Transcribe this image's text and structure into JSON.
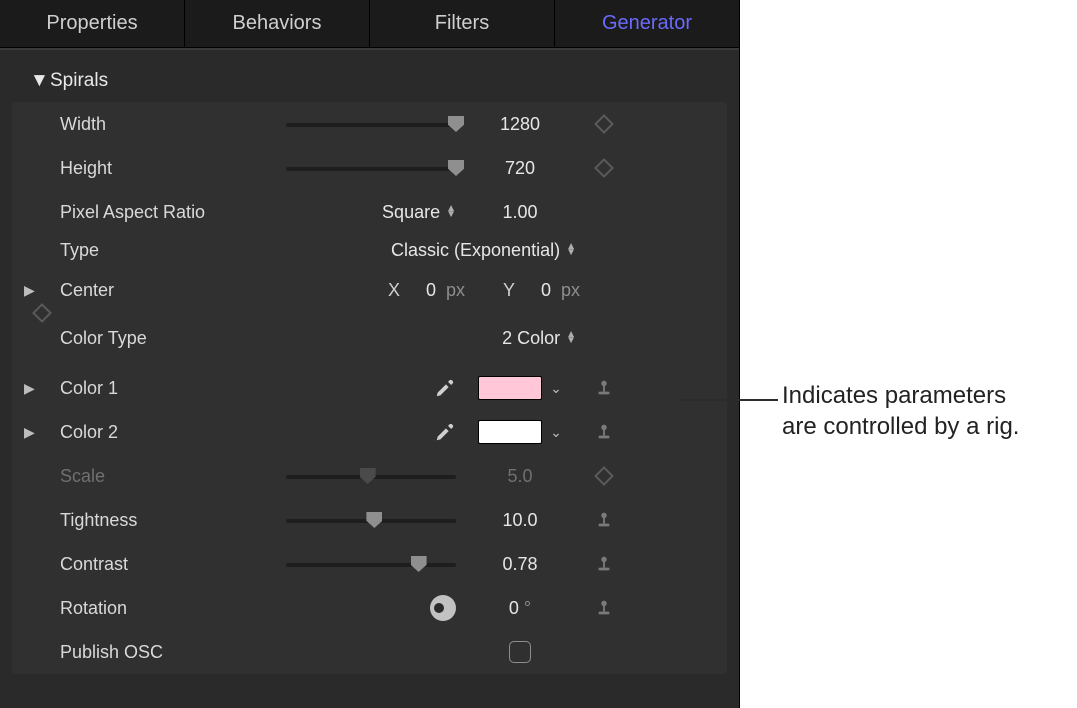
{
  "tabs": {
    "properties": "Properties",
    "behaviors": "Behaviors",
    "filters": "Filters",
    "generator": "Generator"
  },
  "group": {
    "name": "Spirals"
  },
  "params": {
    "width": {
      "label": "Width",
      "value": "1280"
    },
    "height": {
      "label": "Height",
      "value": "720"
    },
    "par": {
      "label": "Pixel Aspect Ratio",
      "select": "Square",
      "value": "1.00"
    },
    "type": {
      "label": "Type",
      "select": "Classic (Exponential)"
    },
    "center": {
      "label": "Center",
      "xLabel": "X",
      "x": "0",
      "xu": "px",
      "yLabel": "Y",
      "y": "0",
      "yu": "px"
    },
    "colorType": {
      "label": "Color Type",
      "select": "2 Color"
    },
    "color1": {
      "label": "Color 1",
      "swatch": "#ffc7d8"
    },
    "color2": {
      "label": "Color 2",
      "swatch": "#ffffff"
    },
    "scale": {
      "label": "Scale",
      "value": "5.0"
    },
    "tight": {
      "label": "Tightness",
      "value": "10.0"
    },
    "contrast": {
      "label": "Contrast",
      "value": "0.78"
    },
    "rotation": {
      "label": "Rotation",
      "value": "0",
      "unit": "°"
    },
    "publish": {
      "label": "Publish OSC"
    }
  },
  "callout": {
    "line1": "Indicates parameters",
    "line2": "are controlled by a rig."
  }
}
